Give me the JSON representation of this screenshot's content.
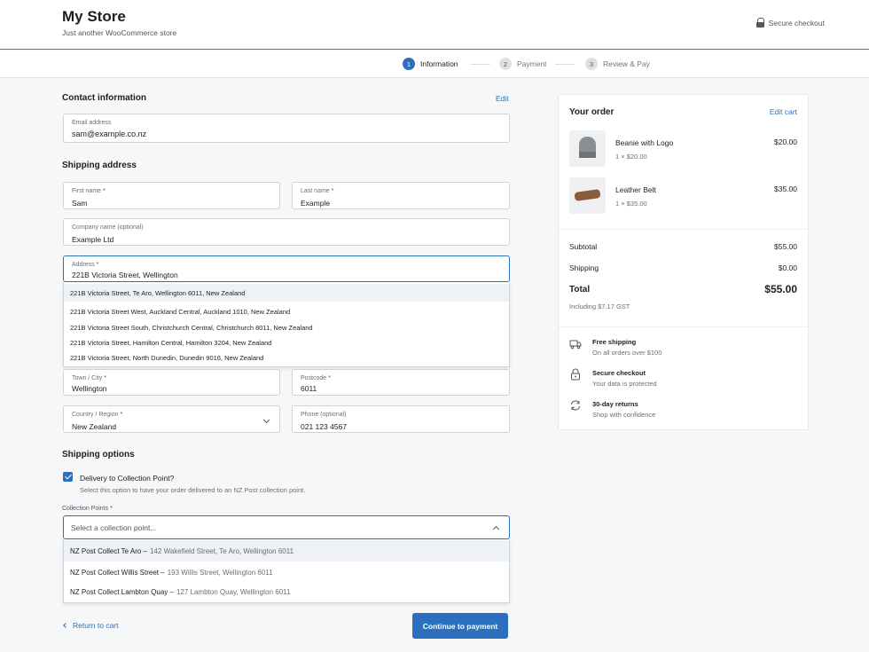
{
  "header": {
    "title": "My Store",
    "tagline": "Just another WooCommerce store",
    "secure": "Secure checkout"
  },
  "steps": [
    {
      "num": "1",
      "label": "Information"
    },
    {
      "num": "2",
      "label": "Payment"
    },
    {
      "num": "3",
      "label": "Review & Pay"
    }
  ],
  "contact": {
    "title": "Contact information",
    "edit": "Edit",
    "email_label": "Email address",
    "email_value": "sam@example.co.nz"
  },
  "shipping": {
    "title": "Shipping address",
    "first_name_label": "First name",
    "first_name_value": "Sam",
    "last_name_label": "Last name",
    "last_name_value": "Example",
    "company_label": "Company name (optional)",
    "company_value": "Example Ltd",
    "address_label": "Address",
    "address_value": "221B Victoria Street, Wellington",
    "suggestions": [
      "221B Victoria Street, Te Aro, Wellington 6011, New Zealand",
      "221B Victoria Street West, Auckland Central, Auckland 1010, New Zealand",
      "221B Victoria Street South, Christchurch Central, Christchurch 8011, New Zealand",
      "221B Victoria Street, Hamilton Central, Hamilton 3204, New Zealand",
      "221B Victoria Street, North Dunedin, Dunedin 9016, New Zealand"
    ],
    "city_label": "Town / City",
    "city_value": "Wellington",
    "postcode_label": "Postcode",
    "postcode_value": "6011",
    "country_label": "Country / Region",
    "country_value": "New Zealand",
    "phone_label": "Phone (optional)",
    "phone_value": "021 123 4567",
    "required_mark": "*"
  },
  "shipping_options": {
    "title": "Shipping options",
    "checkbox_label": "Delivery to Collection Point?",
    "checkbox_checked": true,
    "checkbox_help": "Select this option to have your order delivered to an NZ Post collection point.",
    "collection_label": "Collection Points",
    "collection_placeholder": "Select a collection point...",
    "options": [
      {
        "name": "NZ Post Collect Te Aro –",
        "address": "142 Wakefield Street, Te Aro, Wellington 6011"
      },
      {
        "name": "NZ Post Collect Willis Street –",
        "address": "193 Willis Street, Wellington 6011"
      },
      {
        "name": "NZ Post Collect Lambton Quay –",
        "address": "127 Lambton Quay, Wellington 6011"
      }
    ]
  },
  "footer": {
    "return": "Return to cart",
    "continue": "Continue to payment"
  },
  "order": {
    "title": "Your order",
    "edit_cart": "Edit cart",
    "items": [
      {
        "name": "Beanie with Logo",
        "qty": "1 × $20.00",
        "price": "$20.00"
      },
      {
        "name": "Leather Belt",
        "qty": "1 × $35.00",
        "price": "$35.00"
      }
    ],
    "subtotal_label": "Subtotal",
    "subtotal_value": "$55.00",
    "shipping_label": "Shipping",
    "shipping_value": "$0.00",
    "total_label": "Total",
    "total_value": "$55.00",
    "gst": "Including $7.17 GST",
    "features": [
      {
        "icon": "truck-icon",
        "title": "Free shipping",
        "sub": "On all orders over $100"
      },
      {
        "icon": "lock-icon",
        "title": "Secure checkout",
        "sub": "Your data is protected"
      },
      {
        "icon": "refresh-icon",
        "title": "30-day returns",
        "sub": "Shop with confidence"
      }
    ]
  },
  "colors": {
    "accent": "#2c6fbf",
    "required": "#cc1818"
  }
}
